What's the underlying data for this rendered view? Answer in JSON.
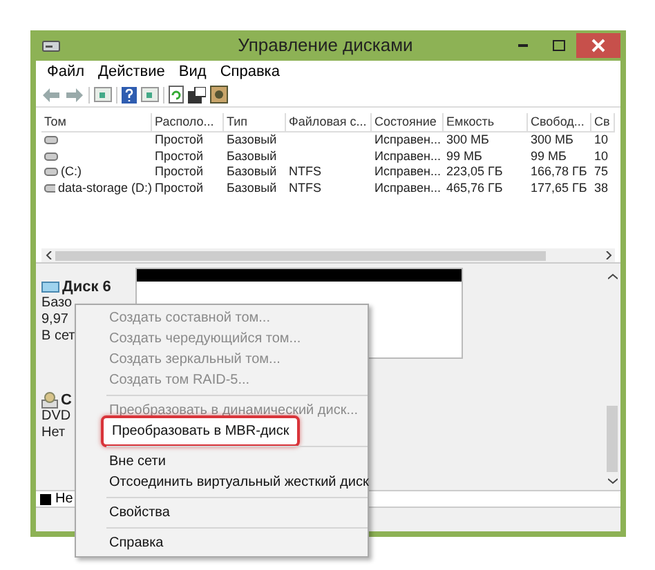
{
  "window": {
    "title": "Управление дисками"
  },
  "menu": [
    "Файл",
    "Действие",
    "Вид",
    "Справка"
  ],
  "table": {
    "columns": [
      "Том",
      "Располо...",
      "Тип",
      "Файловая с...",
      "Состояние",
      "Емкость",
      "Свобод...",
      "Св"
    ],
    "rows": [
      [
        "",
        "Простой",
        "Базовый",
        "",
        "Исправен...",
        "300 МБ",
        "300 МБ",
        "10"
      ],
      [
        "",
        "Простой",
        "Базовый",
        "",
        "Исправен...",
        "99 МБ",
        "99 МБ",
        "10"
      ],
      [
        "(C:)",
        "Простой",
        "Базовый",
        "NTFS",
        "Исправен...",
        "223,05 ГБ",
        "166,78 ГБ",
        "75"
      ],
      [
        "data-storage (D:)",
        "Простой",
        "Базовый",
        "NTFS",
        "Исправен...",
        "465,76 ГБ",
        "177,65 ГБ",
        "38"
      ]
    ]
  },
  "disks": [
    {
      "kind": "disk",
      "name": "Диск 6",
      "lines": [
        "Базо",
        "9,97",
        "В сет"
      ]
    },
    {
      "kind": "cdrom",
      "name": "C",
      "lines": [
        "DVD",
        "Нет"
      ]
    }
  ],
  "legend": [
    "Не"
  ],
  "context_menu": [
    {
      "label": "Создать составной том...",
      "disabled": true,
      "highlighted": false
    },
    {
      "label": "Создать чередующийся том...",
      "disabled": true,
      "highlighted": false
    },
    {
      "label": "Создать зеркальный том...",
      "disabled": true,
      "highlighted": false
    },
    {
      "label": "Создать том RAID-5...",
      "disabled": true,
      "highlighted": false
    },
    {
      "kind": "separator"
    },
    {
      "label": "Преобразовать в динамический диск...",
      "disabled": true,
      "highlighted": false
    },
    {
      "label": "Преобразовать в MBR-диск",
      "disabled": false,
      "highlighted": true
    },
    {
      "kind": "separator"
    },
    {
      "label": "Вне сети",
      "disabled": false,
      "highlighted": false
    },
    {
      "label": "Отсоединить виртуальный жесткий диск",
      "disabled": false,
      "highlighted": false
    },
    {
      "kind": "separator"
    },
    {
      "label": "Свойства",
      "disabled": false,
      "highlighted": false
    },
    {
      "kind": "separator"
    },
    {
      "label": "Справка",
      "disabled": false,
      "highlighted": false
    }
  ]
}
